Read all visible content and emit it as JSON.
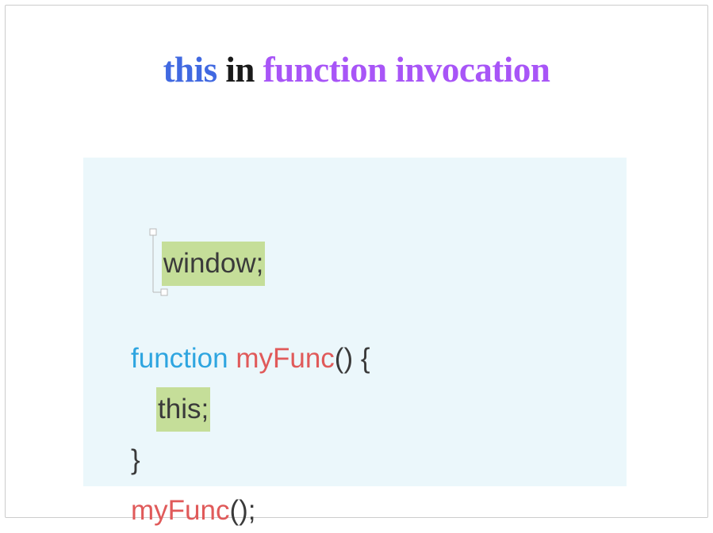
{
  "title": {
    "word1": "this",
    "word2": "in",
    "word3": "function invocation"
  },
  "code": {
    "line1_window": "window;",
    "line2_kw": "function",
    "line2_name": "myFunc",
    "line2_parens": "() {",
    "line3_this": "this;",
    "line4_brace": "}",
    "line5_call": "myFunc",
    "line5_parens": "();"
  }
}
